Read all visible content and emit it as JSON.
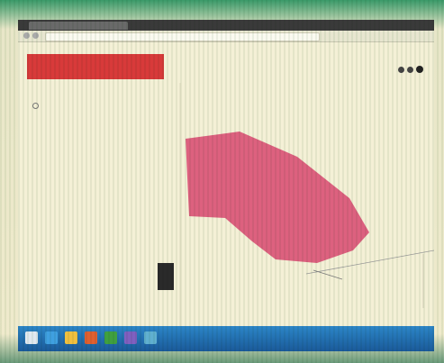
{
  "browser": {
    "tab_title": "",
    "url": ""
  },
  "app": {
    "title": ""
  },
  "sidebar": {
    "title": "",
    "option_label": "",
    "link_label": ""
  },
  "map": {
    "polygon_color": "#d84870",
    "bottom_labels": [
      "",
      ""
    ]
  },
  "status": {
    "footer_text": "",
    "clock": ""
  },
  "taskbar": {
    "icons": [
      "ie-icon",
      "folder-icon",
      "media-icon",
      "chrome-icon",
      "app-icon",
      "app-icon-2"
    ]
  }
}
